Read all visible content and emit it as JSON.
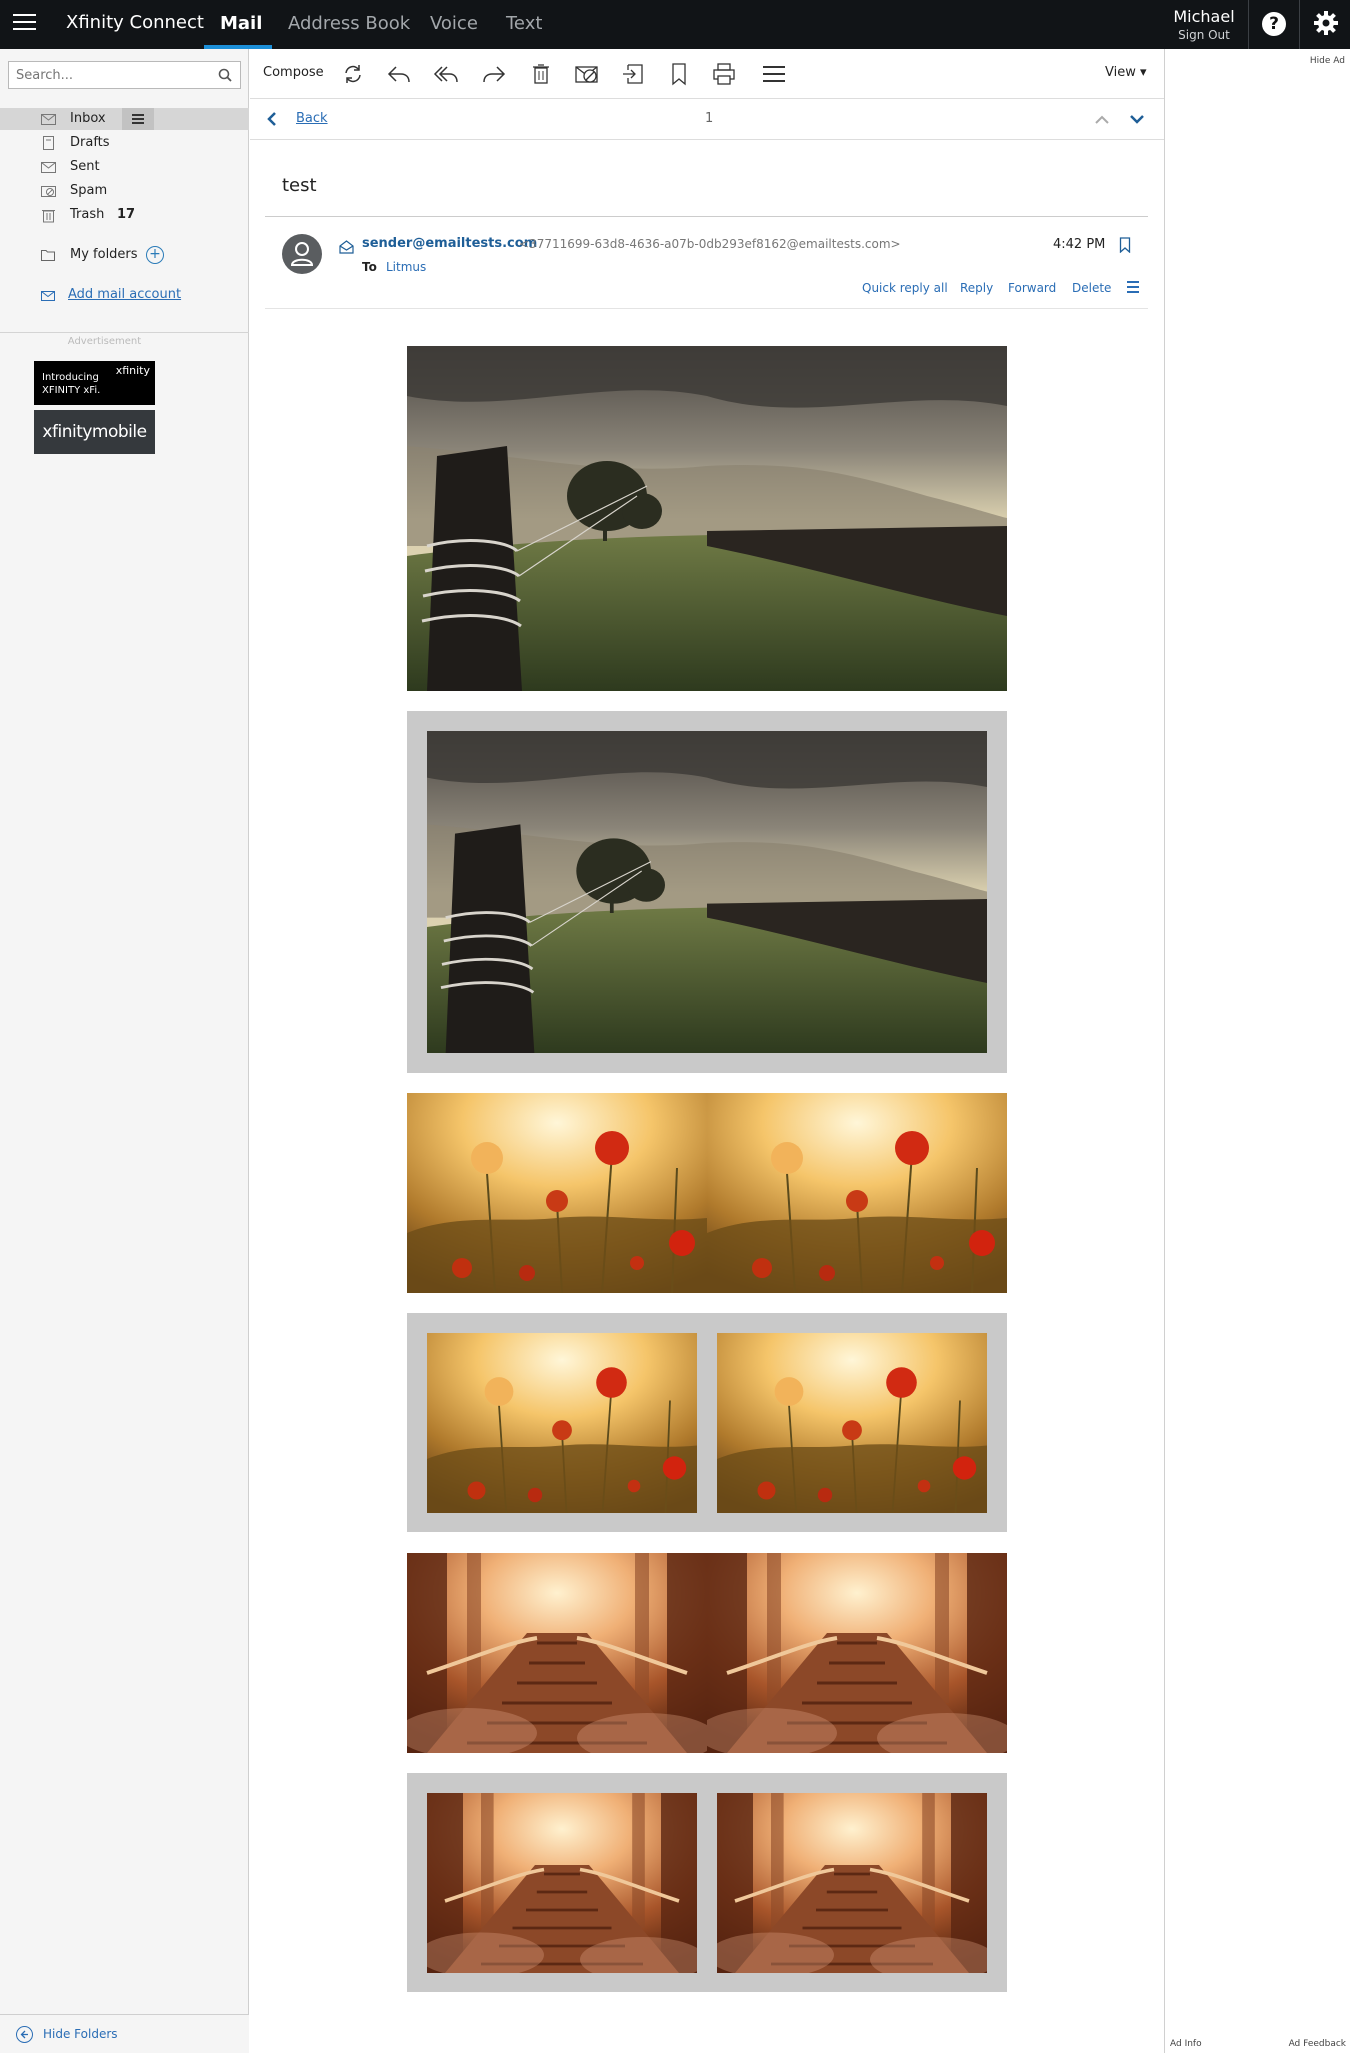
{
  "topbar": {
    "brand": "Xfinity Connect",
    "tabs": [
      {
        "label": "Mail",
        "active": true
      },
      {
        "label": "Address Book",
        "active": false
      },
      {
        "label": "Voice",
        "active": false
      },
      {
        "label": "Text",
        "active": false
      }
    ],
    "user_name": "Michael",
    "sign_out": "Sign Out",
    "help_glyph": "?"
  },
  "sidebar": {
    "search_placeholder": "Search...",
    "folders": [
      {
        "label": "Inbox",
        "icon": "inbox-icon",
        "selected": true
      },
      {
        "label": "Drafts",
        "icon": "drafts-icon"
      },
      {
        "label": "Sent",
        "icon": "sent-icon"
      },
      {
        "label": "Spam",
        "icon": "spam-icon"
      },
      {
        "label": "Trash",
        "icon": "trash-icon",
        "count": "17"
      }
    ],
    "my_folders": "My folders",
    "add_folder_glyph": "+",
    "add_account": "Add mail account",
    "advertisement_label": "Advertisement",
    "ads": [
      {
        "line1": "Introducing",
        "line2": "XFINITY xFi.",
        "brand": "xfinity"
      },
      {
        "text": "xfinitymobile"
      }
    ],
    "hide_folders": "Hide Folders"
  },
  "toolbar": {
    "compose": "Compose",
    "icons": [
      "refresh-icon",
      "reply-icon",
      "reply-all-icon",
      "forward-icon",
      "delete-icon",
      "spam-icon",
      "move-icon",
      "flag-icon",
      "print-icon",
      "more-icon"
    ],
    "view": "View"
  },
  "navbar": {
    "back": "Back",
    "page": "1"
  },
  "message": {
    "subject": "test",
    "from_name": "sender@emailtests.com",
    "from_address": "<37711699-63d8-4636-a07b-0db293ef8162@emailtests.com>",
    "to_label": "To",
    "to_name": "Litmus",
    "time": "4:42 PM",
    "actions": [
      "Quick reply all",
      "Reply",
      "Forward",
      "Delete"
    ]
  },
  "rightpane": {
    "hide_ad": "Hide Ad",
    "ad_info": "Ad Info",
    "ad_feedback": "Ad Feedback"
  },
  "colors": {
    "topbar": "#111417",
    "accent": "#1c8fd8",
    "link": "#2a6db5",
    "frame": "#c9c9c9"
  }
}
